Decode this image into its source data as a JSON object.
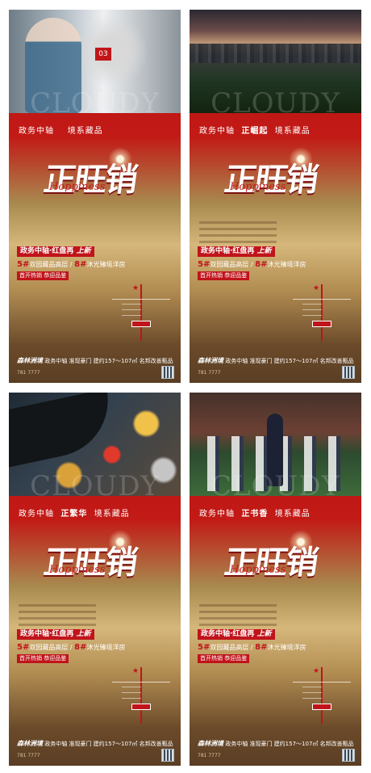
{
  "posters": [
    {
      "badge": "03",
      "watermark": "CLOUDY",
      "slogan_a": "政务中轴",
      "slogan_em": "",
      "slogan_b": "境系藏品",
      "title": "正旺销",
      "script": "Hoppiness",
      "ribbon_a": "政务中轴·红盘再",
      "ribbon_b": "上新",
      "line2_n1": "5#",
      "line2_t1": "双园藏品高层 / ",
      "line2_n2": "8#",
      "line2_t2": "沐光臻境洋房",
      "line3": "首开热销  恭迎品鉴",
      "bottom_brand": "森林洲境",
      "bottom_text": " 政务中轴 准现豪门  建约157～107㎡ 名邦改善甄品",
      "phone": "781 7777"
    },
    {
      "badge": "",
      "watermark": "CLOUDY",
      "slogan_a": "政务中轴",
      "slogan_em": "正崛起",
      "slogan_b": "境系藏品",
      "title": "正旺销",
      "script": "Hoppiness",
      "ribbon_a": "政务中轴·红盘再",
      "ribbon_b": "上新",
      "line2_n1": "5#",
      "line2_t1": "双园藏品高层 / ",
      "line2_n2": "8#",
      "line2_t2": "沐光臻境洋房",
      "line3": "首开热销  恭迎品鉴",
      "bottom_brand": "森林洲境",
      "bottom_text": " 政务中轴 准现豪门  建约157～107㎡ 名邦改善甄品",
      "phone": "781 7777"
    },
    {
      "badge": "",
      "watermark": "CLOUDY",
      "slogan_a": "政务中轴",
      "slogan_em": "正繁华",
      "slogan_b": "境系藏品",
      "title": "正旺销",
      "script": "Hoppiness",
      "ribbon_a": "政务中轴·红盘再",
      "ribbon_b": "上新",
      "line2_n1": "5#",
      "line2_t1": "双园藏品高层 / ",
      "line2_n2": "8#",
      "line2_t2": "沐光臻境洋房",
      "line3": "首开热销  恭迎品鉴",
      "bottom_brand": "森林洲境",
      "bottom_text": " 政务中轴 准现豪门  建约157～107㎡ 名邦改善甄品",
      "phone": "781 7777"
    },
    {
      "badge": "",
      "watermark": "CLOUDY",
      "slogan_a": "政务中轴",
      "slogan_em": "正书香",
      "slogan_b": "境系藏品",
      "title": "正旺销",
      "script": "Hoppiness",
      "ribbon_a": "政务中轴·红盘再",
      "ribbon_b": "上新",
      "line2_n1": "5#",
      "line2_t1": "双园藏品高层 / ",
      "line2_n2": "8#",
      "line2_t2": "沐光臻境洋房",
      "line3": "首开热销  恭迎品鉴",
      "bottom_brand": "森林洲境",
      "bottom_text": " 政务中轴 准现豪门  建约157～107㎡ 名邦改善甄品",
      "phone": "781 7777"
    }
  ],
  "colors": {
    "brand_red": "#c0141a",
    "gold": "#d6b77b",
    "dark_bronze": "#5a3e24"
  }
}
